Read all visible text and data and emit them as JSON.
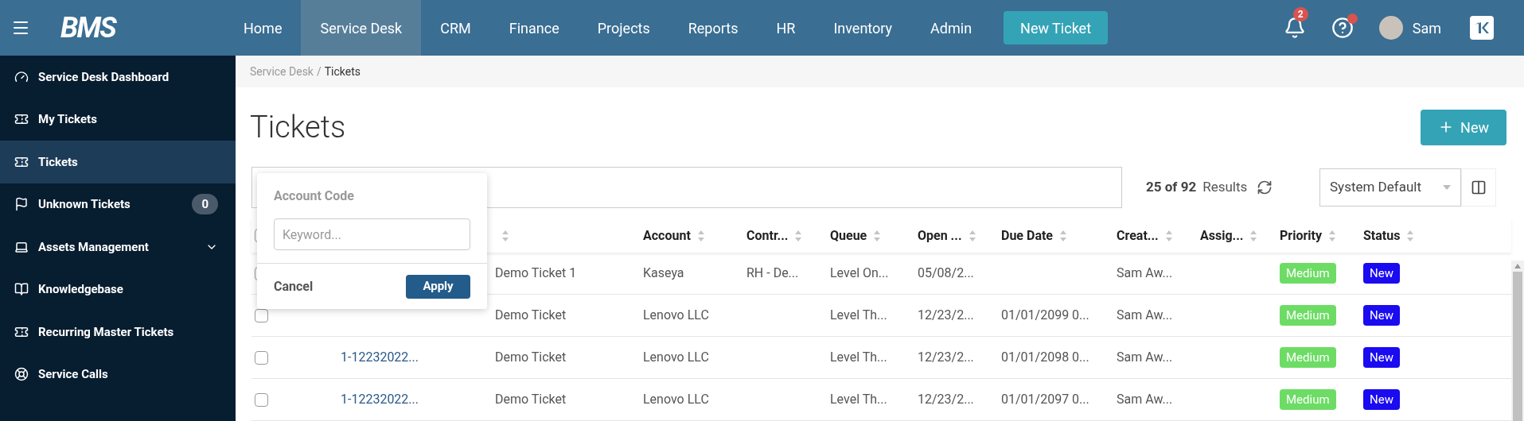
{
  "topbar": {
    "logo": "BMS",
    "nav": [
      {
        "label": "Home",
        "selected": false
      },
      {
        "label": "Service Desk",
        "selected": true
      },
      {
        "label": "CRM",
        "selected": false
      },
      {
        "label": "Finance",
        "selected": false
      },
      {
        "label": "Projects",
        "selected": false
      },
      {
        "label": "Reports",
        "selected": false
      },
      {
        "label": "HR",
        "selected": false
      },
      {
        "label": "Inventory",
        "selected": false
      },
      {
        "label": "Admin",
        "selected": false
      }
    ],
    "new_ticket": "New Ticket",
    "notifications": "2",
    "help_alert": true,
    "user": "Sam"
  },
  "sidebar": {
    "items": [
      {
        "label": "Service Desk Dashboard",
        "kind": "gauge",
        "selected": false
      },
      {
        "label": "My Tickets",
        "kind": "ticket",
        "selected": false
      },
      {
        "label": "Tickets",
        "kind": "ticket",
        "selected": true
      },
      {
        "label": "Unknown Tickets",
        "kind": "flag",
        "selected": false,
        "badge": "0"
      },
      {
        "label": "Assets Management",
        "kind": "laptop",
        "selected": false,
        "expanded": false
      },
      {
        "label": "Knowledgebase",
        "kind": "book",
        "selected": false
      },
      {
        "label": "Recurring Master Tickets",
        "kind": "ticket",
        "selected": false
      },
      {
        "label": "Service Calls",
        "kind": "lifebuoy",
        "selected": false
      }
    ]
  },
  "breadcrumb": {
    "items": [
      "Service Desk",
      "Tickets"
    ],
    "separator": "/"
  },
  "title": "Tickets",
  "new_button": "New",
  "results": {
    "count": "25 of 92",
    "label": "Results"
  },
  "view_select": "System Default",
  "filter_popup": {
    "title": "Account Code",
    "placeholder": "Keyword...",
    "cancel": "Cancel",
    "apply": "Apply"
  },
  "table": {
    "select_all": {
      "checked": false
    },
    "columns": [
      {},
      {},
      {},
      {
        "label": "Account"
      },
      {
        "label": "Contr..."
      },
      {
        "label": "Queue"
      },
      {
        "label": "Open ..."
      },
      {
        "label": "Due Date"
      },
      {
        "label": "Creat..."
      },
      {
        "label": "Assig..."
      },
      {
        "label": "Priority"
      },
      {
        "label": "Status"
      }
    ],
    "rows": [
      {
        "checked": false,
        "title": "Demo Ticket 1",
        "account": "Kaseya",
        "contract": "RH - De...",
        "queue": "Level On...",
        "opened": "05/08/2...",
        "creator": "Sam Aw...",
        "priority": "Medium",
        "status": "New"
      },
      {
        "checked": false,
        "title": "Demo Ticket",
        "account": "Lenovo LLC",
        "queue": "Level Th...",
        "opened": "12/23/2...",
        "due": "01/01/2099 0...",
        "creator": "Sam Aw...",
        "priority": "Medium",
        "status": "New"
      },
      {
        "checked": false,
        "number": "1-12232022...",
        "title": "Demo Ticket",
        "account": "Lenovo LLC",
        "queue": "Level Th...",
        "opened": "12/23/2...",
        "due": "01/01/2098 0...",
        "creator": "Sam Aw...",
        "priority": "Medium",
        "status": "New"
      },
      {
        "checked": false,
        "number": "1-12232022...",
        "title": "Demo Ticket",
        "account": "Lenovo LLC",
        "queue": "Level Th...",
        "opened": "12/23/2...",
        "due": "01/01/2097 0...",
        "creator": "Sam Aw...",
        "priority": "Medium",
        "status": "New"
      }
    ]
  }
}
